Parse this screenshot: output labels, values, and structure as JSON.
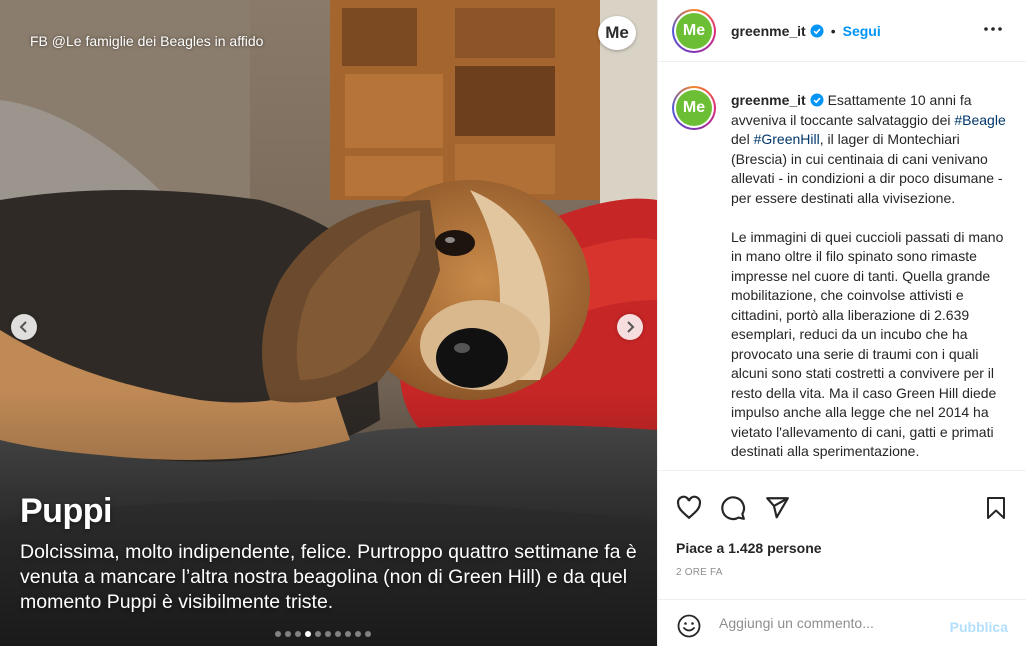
{
  "media": {
    "credit": "FB @Le famiglie dei Beagles in affido",
    "brand_badge": "Me",
    "title": "Puppi",
    "text": "Dolcissima, molto indipendente, felice. Purtroppo quattro settimane fa è venuta a mancare l’altra nostra beagolina (non di Green Hill) e da quel momento Puppi è visibilmente triste.",
    "carousel": {
      "total": 10,
      "active_index": 3
    }
  },
  "header": {
    "avatar_text": "Me",
    "username": "greenme_it",
    "separator": "•",
    "follow_label": "Segui"
  },
  "caption": {
    "username": "greenme_it",
    "p1_a": "Esattamente 10 anni fa avveniva il toccante salvataggio dei ",
    "tag1": "#Beagle",
    "p1_b": " del ",
    "tag2": "#GreenHill",
    "p1_c": ", il lager di Montechiari (Brescia) in cui centinaia di cani venivano allevati - in condizioni a dir poco disumane - per essere destinati alla vivisezione.",
    "p2": "Le immagini di quei cuccioli passati di mano in mano oltre il filo spinato sono rimaste impresse nel cuore di tanti. Quella grande mobilitazione, che coinvolse attivisti e cittadini, portò alla liberazione di 2.639 esemplari, reduci da un incubo che ha provocato una serie di traumi con i quali alcuni sono stati costretti a convivere per il resto della vita. Ma il caso Green Hill diede impulso anche alla legge che nel 2014 ha vietato l'allevamento di cani, gatti e primati destinati alla sperimentazione."
  },
  "likes_text": "Piace a 1.428 persone",
  "time_text": "2 ORE FA",
  "comment": {
    "placeholder": "Aggiungi un commento...",
    "publish_label": "Pubblica"
  },
  "colors": {
    "link": "#0095f6",
    "hashtag": "#00376b",
    "brand_green": "#6cbf34",
    "muted": "#8e8e8e"
  }
}
